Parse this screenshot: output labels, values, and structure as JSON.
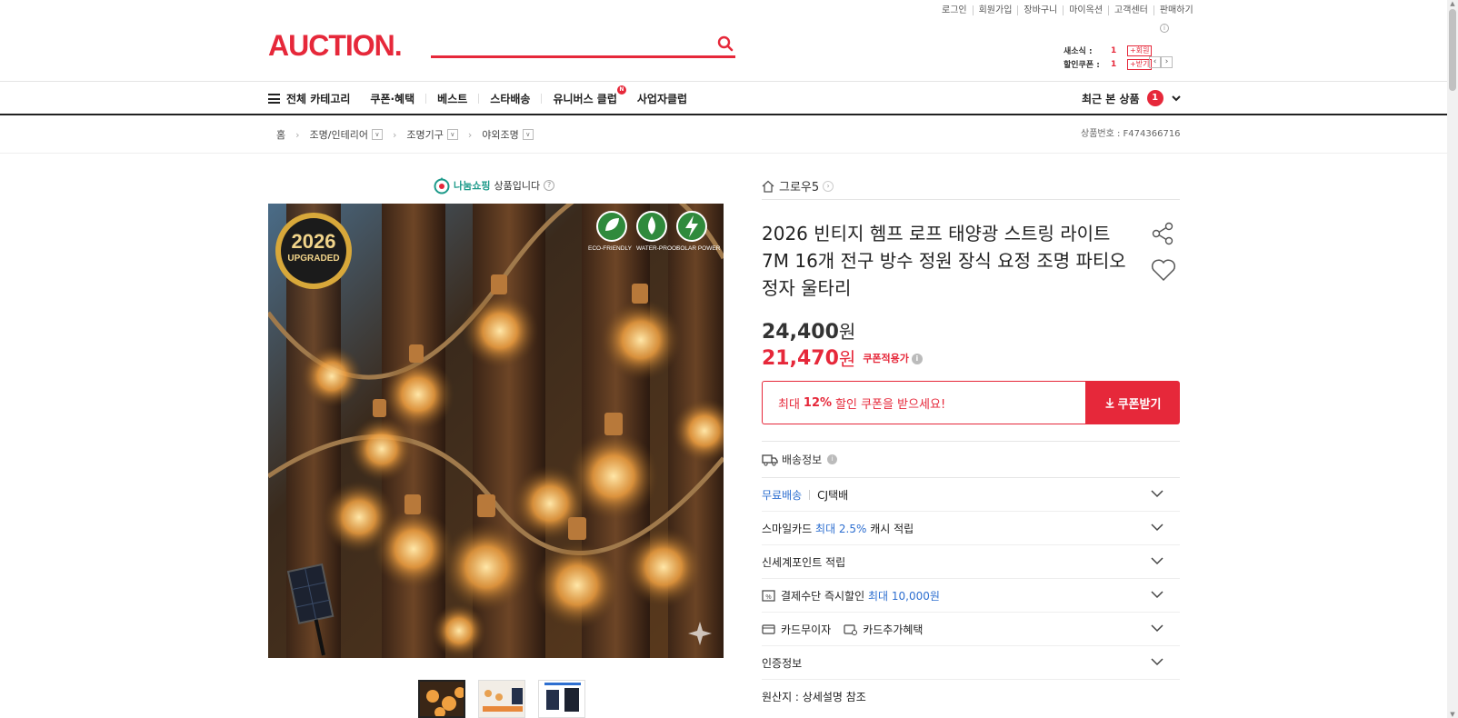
{
  "utility_links": [
    "로그인",
    "회원가입",
    "장바구니",
    "마이옥션",
    "고객센터",
    "판매하기"
  ],
  "logo": "AUCTION.",
  "search": {
    "placeholder": ""
  },
  "mini": {
    "new_msg_label": "새소식 :",
    "new_msg_count": "1",
    "new_msg_tag": "+회원",
    "coupon_label": "할인쿠폰 :",
    "coupon_count": "1",
    "coupon_tag": "+받기"
  },
  "gnb": {
    "all_category": "전체 카테고리",
    "items": [
      "쿠폰·혜택",
      "베스트",
      "스타배송",
      "유니버스 클럽",
      "사업자클럽"
    ],
    "universe_badge": "N",
    "recent_label": "최근 본 상품",
    "recent_count": "1"
  },
  "breadcrumb": {
    "home": "홈",
    "levels": [
      "조명/인테리어",
      "조명기구",
      "야외조명"
    ],
    "product_no": "상품번호 : F474366716"
  },
  "nanum": {
    "brand": "나눔쇼핑",
    "text": "상품입니다"
  },
  "image": {
    "badge_year": "2026",
    "badge_text": "UPGRADED",
    "features": [
      "ECO-FRIENDLY",
      "WATER-PROOF",
      "SOLAR POWER"
    ]
  },
  "product": {
    "seller": "그로우5",
    "title": "2026 빈티지 헴프 로프 태양광 스트링 라이트 7M 16개 전구 방수 정원 장식 요정 조명 파티오 정자 울타리",
    "price": "24,400",
    "coupon_price": "21,470",
    "won": "원",
    "coupon_applied": "쿠폰적용가",
    "coupon_msg_pre": "최대",
    "coupon_msg_pct": "12%",
    "coupon_msg_post": "할인 쿠폰을 받으세요!",
    "coupon_btn": "쿠폰받기"
  },
  "shipping": {
    "header": "배송정보",
    "free": "무료배송",
    "carrier": "CJ택배",
    "smile_pre": "스마일카드",
    "smile_blue": "최대 2.5%",
    "smile_post": "캐시 적립",
    "ssg": "신세계포인트 적립",
    "pay_pre": "결제수단 즉시할인",
    "pay_blue": "최대 10,000원",
    "card_free": "카드무이자",
    "card_extra": "카드추가혜택",
    "cert": "인증정보",
    "origin": "원산지 : 상세설명 참조"
  },
  "colors": {
    "accent": "#e6283a",
    "link_blue": "#2e6fd0"
  }
}
